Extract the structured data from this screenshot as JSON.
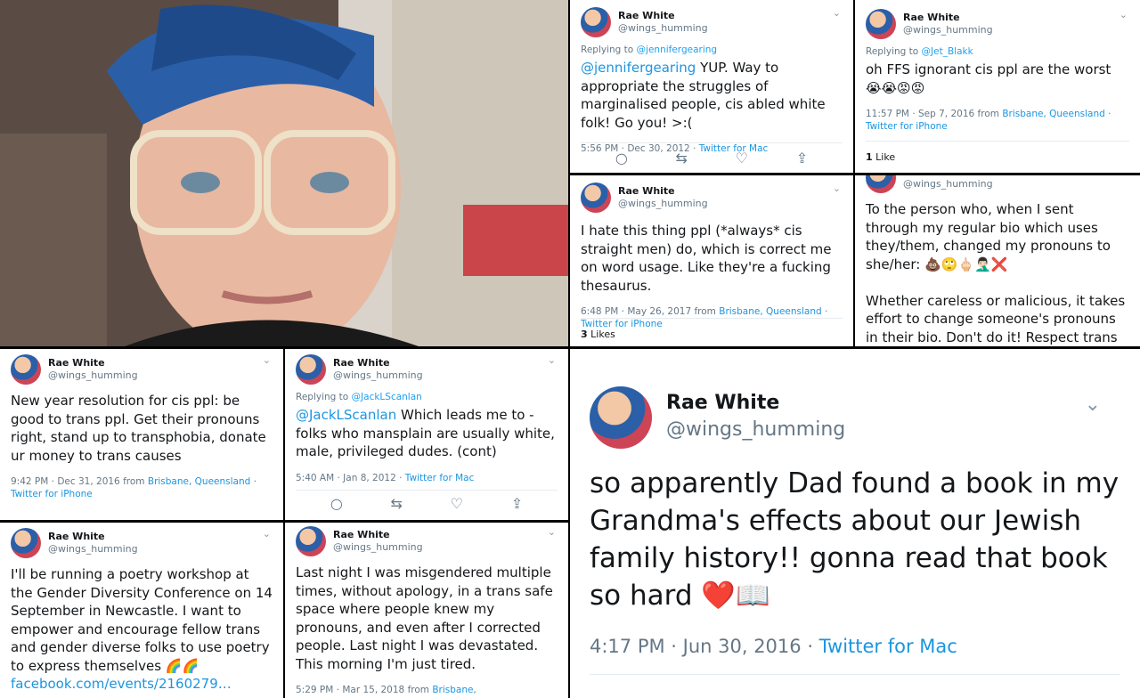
{
  "user": {
    "name": "Rae White",
    "handle": "@wings_humming"
  },
  "tweets": {
    "t1": {
      "reply_prefix": "Replying to ",
      "reply_to": "@jennifergearing",
      "mention": "@jennifergearing",
      "text": " YUP. Way to appropriate the struggles of marginalised people, cis abled white folk! Go you! >:(",
      "time": "5:56 PM · Dec 30, 2012 · ",
      "client": "Twitter for Mac"
    },
    "t2": {
      "reply_prefix": "Replying to ",
      "reply_to": "@Jet_Blakk",
      "text": "oh FFS ignorant cis ppl are the worst 😭😭😡😡",
      "time": "11:57 PM · Sep 7, 2016 from ",
      "location": "Brisbane, Queensland",
      "sep": " · ",
      "client": "Twitter for iPhone",
      "likes": "1",
      "likes_label": " Like"
    },
    "t3": {
      "text": "I hate this thing ppl (*always* cis straight men) do, which is correct me on word usage. Like they're a fucking thesaurus.",
      "time": "6:48 PM · May 26, 2017 from ",
      "location": "Brisbane, Queensland",
      "sep": " · ",
      "client": "Twitter for iPhone",
      "likes": "3",
      "likes_label": " Likes"
    },
    "t4": {
      "text": "To the person who, when I sent through my regular bio which uses they/them, changed my pronouns to she/her: 💩🙄🖕🏻🤦🏻‍♂️❌\n\nWhether careless or malicious, it takes effort to change someone's pronouns in their bio. Don't do it! Respect trans ppl &"
    },
    "t5": {
      "text": "New year resolution for cis ppl: be good to trans ppl. Get their pronouns right, stand up to transphobia, donate ur money to trans causes",
      "time": "9:42 PM · Dec 31, 2016 from ",
      "location": "Brisbane, Queensland",
      "sep": " · ",
      "client": "Twitter for iPhone"
    },
    "t6": {
      "reply_prefix": "Replying to ",
      "reply_to": "@JackLScanlan",
      "mention": "@JackLScanlan",
      "text": " Which leads me to - folks who mansplain are usually white, male, privileged dudes. (cont)",
      "time": "5:40 AM · Jan 8, 2012 · ",
      "client": "Twitter for Mac"
    },
    "t7": {
      "text": "I'll be running a poetry workshop at the Gender Diversity Conference on 14 September in Newcastle. I want to empower and encourage fellow trans and gender diverse folks to use poetry to express themselves 🌈🌈",
      "link": "facebook.com/events/2160279…"
    },
    "t8": {
      "text": "Last night I was misgendered multiple times, without apology, in a trans safe space where people knew my pronouns, and even after I corrected people. Last night I was devastated. This morning I'm just tired.",
      "time": "5:29 PM · Mar 15, 2018 from ",
      "location": "Brisbane,"
    },
    "t9": {
      "text": "so apparently Dad found a book in my Grandma's effects about our Jewish family history!! gonna read that book so hard ❤️📖",
      "time": "4:17 PM · Jun 30, 2016 · ",
      "client": "Twitter for Mac"
    }
  },
  "icons": {
    "reply": "reply-icon",
    "retweet": "retweet-icon",
    "like": "heart-icon",
    "share": "share-icon",
    "more": "chevron-down-icon"
  },
  "colors": {
    "link": "#1b95e0",
    "meta": "#657786",
    "heart": "#e0245e"
  }
}
